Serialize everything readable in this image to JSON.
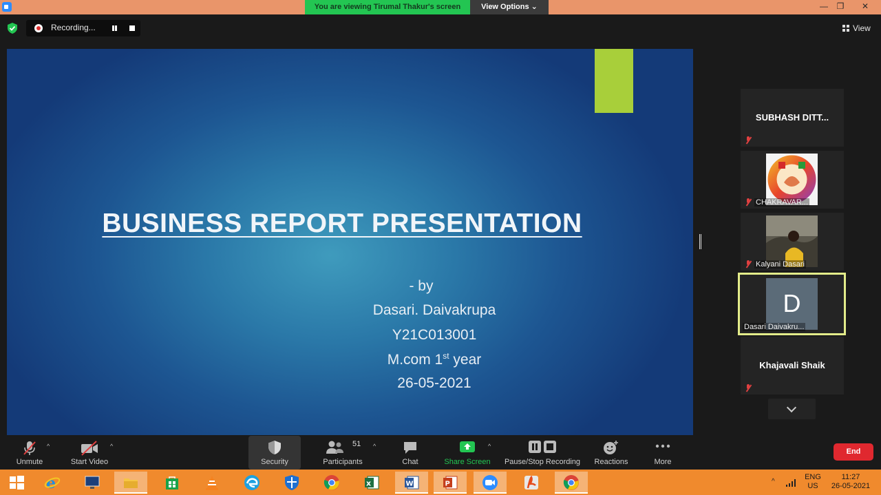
{
  "titlebar": {
    "banner": "You are viewing Tirumal Thakur's screen",
    "view_options": "View Options ⌄",
    "minimize": "—",
    "restore": "❐",
    "close": "✕"
  },
  "recording": {
    "label": "Recording..."
  },
  "view": {
    "label": "View"
  },
  "slide": {
    "title": "BUSINESS REPORT PRESENTATION",
    "by": "- by",
    "author": "Dasari. Daivakrupa",
    "roll": "Y21C013001",
    "course_prefix": "M.com 1",
    "course_sup": "st",
    "course_suffix": " year",
    "date": "26-05-2021"
  },
  "participants": [
    {
      "name": "SUBHASH DITT...",
      "muted": true
    },
    {
      "name": "CHAKRAVAR...",
      "muted": true
    },
    {
      "name": "Kalyani Dasari",
      "muted": true
    },
    {
      "name": "Dasari Daivakru...",
      "initial": "D",
      "active": true
    },
    {
      "name": "Khajavali Shaik",
      "muted": true
    }
  ],
  "toolbar": {
    "unmute": "Unmute",
    "start_video": "Start Video",
    "security": "Security",
    "participants_count": "51",
    "participants": "Participants",
    "chat": "Chat",
    "share_screen": "Share Screen",
    "pause_stop": "Pause/Stop Recording",
    "reactions": "Reactions",
    "more": "More",
    "end": "End"
  },
  "taskbar": {
    "lang": "ENG",
    "region": "US",
    "time": "11:27",
    "date": "26-05-2021"
  },
  "colors": {
    "banner_green": "#23c552",
    "share_green": "#23c552",
    "end_red": "#e0282f",
    "taskbar": "#f08a2d",
    "active_tile_border": "#e3ec8a"
  }
}
